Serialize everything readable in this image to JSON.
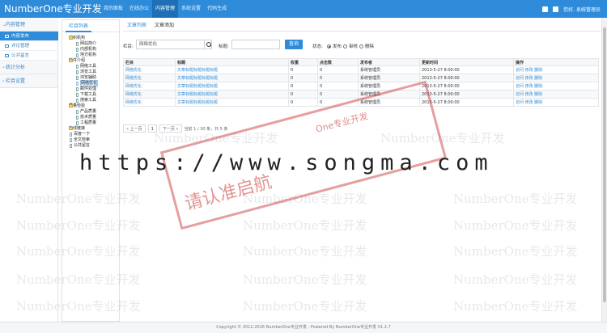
{
  "brand": {
    "title": "NumberOne专业开发"
  },
  "topnav": [
    {
      "label": "我的面板",
      "active": false
    },
    {
      "label": "在线办公",
      "active": false
    },
    {
      "label": "内容管理",
      "active": true
    },
    {
      "label": "系统设置",
      "active": false
    },
    {
      "label": "代码生成",
      "active": false
    }
  ],
  "user": {
    "greeting": "您好, 系统管理员"
  },
  "leftmenu": {
    "group1": "内容管理",
    "items": [
      "内容发布",
      "评论管理",
      "公共留言"
    ],
    "group2": "统计分析",
    "group3": "栏目设置"
  },
  "tree": {
    "tab": "栏目列表",
    "nodes": [
      {
        "label": "组织机构",
        "level": 0,
        "folder": true
      },
      {
        "label": "网站简介",
        "level": 2,
        "folder": false
      },
      {
        "label": "内部机构",
        "level": 2,
        "folder": false
      },
      {
        "label": "地方机构",
        "level": 2,
        "folder": false
      },
      {
        "label": "软件介绍",
        "level": 0,
        "folder": true
      },
      {
        "label": "网络工具",
        "level": 2,
        "folder": false
      },
      {
        "label": "浏览工具",
        "level": 2,
        "folder": false
      },
      {
        "label": "浏览辅助",
        "level": 2,
        "folder": false
      },
      {
        "label": "网络优化",
        "level": 2,
        "folder": false,
        "selected": true
      },
      {
        "label": "邮件处理",
        "level": 2,
        "folder": false
      },
      {
        "label": "下载工具",
        "level": 2,
        "folder": false
      },
      {
        "label": "搜索工具",
        "level": 2,
        "folder": false
      },
      {
        "label": "质量检验",
        "level": 0,
        "folder": true
      },
      {
        "label": "产品质量",
        "level": 2,
        "folder": false
      },
      {
        "label": "技术质量",
        "level": 2,
        "folder": false
      },
      {
        "label": "工程质量",
        "level": 2,
        "folder": false
      },
      {
        "label": "在线链接",
        "level": 0,
        "folder": true
      },
      {
        "label": "百度一下",
        "level": 1,
        "folder": false
      },
      {
        "label": "全文检索",
        "level": 1,
        "folder": false
      },
      {
        "label": "公共留言",
        "level": 1,
        "folder": false
      }
    ]
  },
  "tabs": [
    "文章列表",
    "文章添加"
  ],
  "search": {
    "column_label": "栏目:",
    "column_value": "网络优化",
    "title_label": "标题:",
    "title_value": "",
    "button": "查询",
    "status_label": "状态:",
    "status_options": [
      "发布",
      "审核",
      "删除"
    ]
  },
  "table": {
    "headers": [
      "栏目",
      "标题",
      "权重",
      "点击数",
      "发布者",
      "更新时间",
      "操作"
    ],
    "rows": [
      [
        "网络优化",
        "文章标题标题标题标题",
        "0",
        "0",
        "系统管理员",
        "2013-5-27 8:00:00",
        "访问 修改 删除"
      ],
      [
        "网络优化",
        "文章标题标题标题标题",
        "0",
        "0",
        "系统管理员",
        "2013-5-27 8:00:00",
        "访问 修改 删除"
      ],
      [
        "网络优化",
        "文章标题标题标题标题",
        "0",
        "0",
        "系统管理员",
        "2013-5-27 8:00:00",
        "访问 修改 删除"
      ],
      [
        "网络优化",
        "文章标题标题标题标题",
        "0",
        "0",
        "系统管理员",
        "2013-5-27 8:00:00",
        "访问 修改 删除"
      ],
      [
        "网络优化",
        "文章标题标题标题标题",
        "0",
        "0",
        "系统管理员",
        "2013-5-27 8:00:00",
        "访问 修改 删除"
      ]
    ]
  },
  "pager": {
    "prev": "« 上一页",
    "page": "1",
    "next": "下一页 »",
    "info": "当前 1 / 30 条，共 5 条"
  },
  "watermark": {
    "url": "https://www.songma.com",
    "stamp": "请认准启航",
    "stamp_sub": "One专业开发",
    "faint": "NumberOne专业开发"
  },
  "footer": "Copyright © 2012-2016 NumberOne专业开发 - Powered By NumberOne专业开发 V1.2.7"
}
